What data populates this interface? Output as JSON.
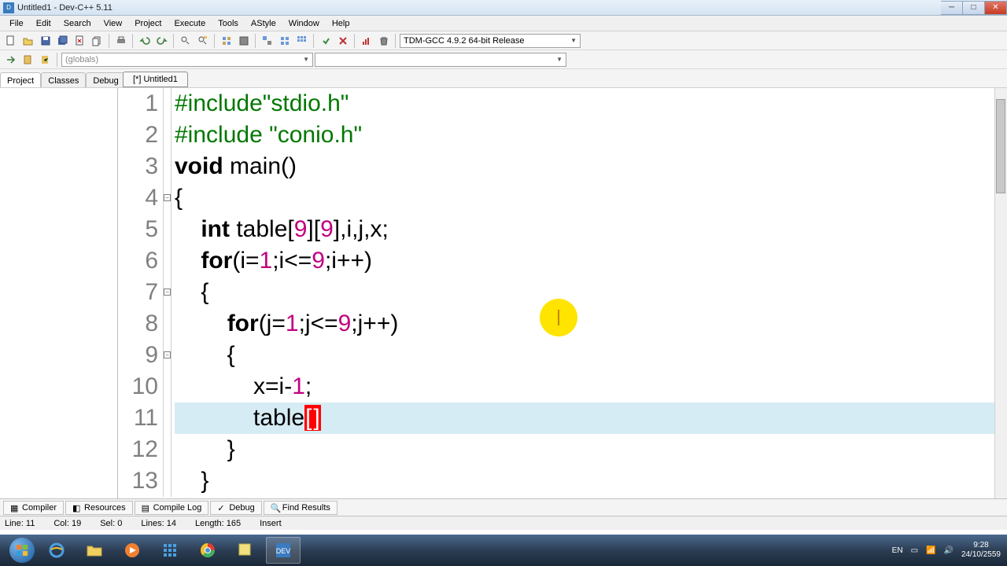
{
  "title": "Untitled1 - Dev-C++ 5.11",
  "menus": [
    "File",
    "Edit",
    "Search",
    "View",
    "Project",
    "Execute",
    "Tools",
    "AStyle",
    "Window",
    "Help"
  ],
  "compiler_combo": "TDM-GCC 4.9.2 64-bit Release",
  "globals_combo": "(globals)",
  "side_tabs": [
    "Project",
    "Classes",
    "Debug"
  ],
  "file_tab": "[*] Untitled1",
  "code": {
    "lines": [
      {
        "n": "1",
        "pre": "#include",
        "str": "\"stdio.h\""
      },
      {
        "n": "2",
        "pre": "#include ",
        "str": "\"conio.h\""
      },
      {
        "n": "3",
        "tokens": [
          {
            "t": "kw",
            "v": "void"
          },
          {
            "t": "",
            "v": " main()"
          }
        ]
      },
      {
        "n": "4",
        "plain": "{"
      },
      {
        "n": "5",
        "tokens": [
          {
            "t": "",
            "v": "    "
          },
          {
            "t": "kw",
            "v": "int"
          },
          {
            "t": "",
            "v": " table["
          },
          {
            "t": "num",
            "v": "9"
          },
          {
            "t": "",
            "v": "]["
          },
          {
            "t": "num",
            "v": "9"
          },
          {
            "t": "",
            "v": "],i,j,x;"
          }
        ]
      },
      {
        "n": "6",
        "tokens": [
          {
            "t": "",
            "v": "    "
          },
          {
            "t": "kw",
            "v": "for"
          },
          {
            "t": "",
            "v": "(i="
          },
          {
            "t": "num",
            "v": "1"
          },
          {
            "t": "",
            "v": ";i<="
          },
          {
            "t": "num",
            "v": "9"
          },
          {
            "t": "",
            "v": ";i++)"
          }
        ]
      },
      {
        "n": "7",
        "plain": "    {"
      },
      {
        "n": "8",
        "tokens": [
          {
            "t": "",
            "v": "        "
          },
          {
            "t": "kw",
            "v": "for"
          },
          {
            "t": "",
            "v": "(j="
          },
          {
            "t": "num",
            "v": "1"
          },
          {
            "t": "",
            "v": ";j<="
          },
          {
            "t": "num",
            "v": "9"
          },
          {
            "t": "",
            "v": ";j++)"
          }
        ]
      },
      {
        "n": "9",
        "plain": "        {"
      },
      {
        "n": "10",
        "tokens": [
          {
            "t": "",
            "v": "            x=i-"
          },
          {
            "t": "num",
            "v": "1"
          },
          {
            "t": "",
            "v": ";"
          }
        ]
      },
      {
        "n": "11",
        "current": true,
        "tokens": [
          {
            "t": "",
            "v": "            table"
          },
          {
            "t": "br",
            "v": "["
          },
          {
            "t": "br",
            "v": "]"
          }
        ]
      },
      {
        "n": "12",
        "plain": "        }"
      },
      {
        "n": "13",
        "plain": "    }"
      }
    ]
  },
  "bottom_tabs": [
    "Compiler",
    "Resources",
    "Compile Log",
    "Debug",
    "Find Results"
  ],
  "status": {
    "line": "Line:   11",
    "col": "Col:   19",
    "sel": "Sel:   0",
    "lines": "Lines:   14",
    "length": "Length:   165",
    "mode": "Insert"
  },
  "tray": {
    "lang": "EN",
    "time": "9:28",
    "date": "24/10/2559"
  }
}
